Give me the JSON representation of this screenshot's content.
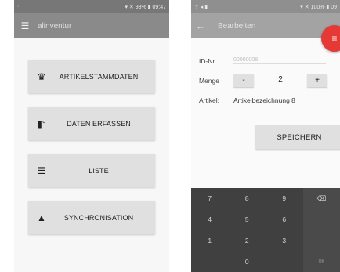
{
  "left": {
    "status": {
      "left_icon": "·",
      "right_text": "▾ ✕ 93% ▮ 09:47"
    },
    "app_name": "alinventur",
    "menu": [
      {
        "label": "ARTIKELSTAMMDATEN",
        "icon": "crown-icon"
      },
      {
        "label": "DATEN ERFASSEN",
        "icon": "scanner-icon"
      },
      {
        "label": "LISTE",
        "icon": "list-icon"
      },
      {
        "label": "SYNCHRONISATION",
        "icon": "sync-icon"
      }
    ]
  },
  "right": {
    "status": {
      "left_icon": "⇡ ◂ ▮",
      "right_text": "▾ ✕ 100% ▮ 09"
    },
    "title": "Bearbeiten",
    "fab_icon": "≡",
    "form": {
      "id_label": "ID-Nr.",
      "id_value": "00000008",
      "menge_label": "Menge",
      "minus": "-",
      "menge_value": "2",
      "plus": "+",
      "artikel_label": "Artikel:",
      "artikel_value": "Artikelbezeichnung 8"
    },
    "save_label": "SPEICHERN",
    "keypad": [
      [
        "7",
        "8",
        "9",
        "⌫"
      ],
      [
        "4",
        "5",
        "6",
        ""
      ],
      [
        "1",
        "2",
        "3",
        ""
      ],
      [
        "",
        "0",
        "",
        "OK"
      ]
    ]
  },
  "colors": {
    "accent": "#e53935",
    "appbar_left": "#8a8a8a",
    "appbar_right": "#a3a3a3",
    "keypad": "#404040"
  }
}
